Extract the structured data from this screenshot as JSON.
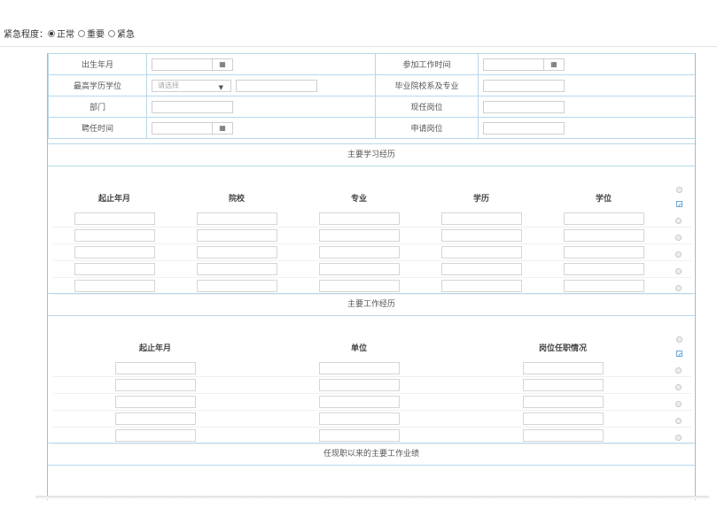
{
  "urgency": {
    "label": "紧急程度：",
    "options": [
      {
        "label": "正常",
        "selected": true
      },
      {
        "label": "重要",
        "selected": false
      },
      {
        "label": "紧急",
        "selected": false
      }
    ]
  },
  "info": {
    "birth": "出生年月",
    "work_start": "参加工作时间",
    "edu": "最高学历学位",
    "edu_placeholder": "请选择",
    "school_major": "毕业院校系及专业",
    "dept": "部门",
    "position": "现任岗位",
    "hire": "聘任时间",
    "apply": "申请岗位"
  },
  "study": {
    "title": "主要学习经历",
    "columns": [
      "起止年月",
      "院校",
      "专业",
      "学历",
      "学位"
    ],
    "rows": 5
  },
  "work": {
    "title": "主要工作经历",
    "columns": [
      "起止年月",
      "单位",
      "岗位任职情况"
    ],
    "rows": 5
  },
  "achievement": {
    "title": "任现职以来的主要工作业绩"
  },
  "icons": {
    "calendar": "calendar-icon",
    "dropdown": "chevron-down-icon",
    "add": "add-circle-icon",
    "edit": "edit-icon",
    "remove": "remove-circle-icon"
  }
}
